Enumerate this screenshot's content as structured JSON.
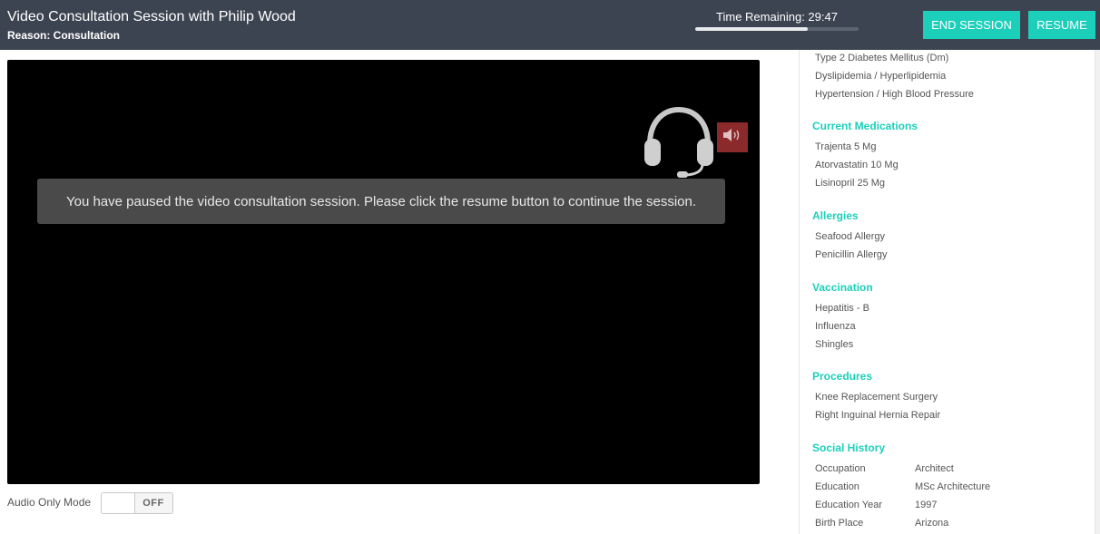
{
  "header": {
    "title": "Video Consultation Session with Philip Wood",
    "reason": "Reason: Consultation",
    "timer_text": "Time Remaining: 29:47",
    "timer_progress": 0.69,
    "end_session_label": "END SESSION",
    "resume_label": "RESUME"
  },
  "video": {
    "paused_message": "You have paused the video consultation session. Please click the resume button to continue the session.",
    "headset_icon": "headset-icon",
    "speaker_icon": "speaker-muted-icon"
  },
  "audio_only": {
    "label": "Audio Only Mode",
    "state": "OFF"
  },
  "sidebar": {
    "conditions": [
      "Type 2 Diabetes Mellitus (Dm)",
      "Dyslipidemia / Hyperlipidemia",
      "Hypertension / High Blood Pressure"
    ],
    "medications": {
      "title": "Current Medications",
      "items": [
        "Trajenta 5 Mg",
        "Atorvastatin 10 Mg",
        "Lisinopril 25 Mg"
      ]
    },
    "allergies": {
      "title": "Allergies",
      "items": [
        "Seafood Allergy",
        "Penicillin Allergy"
      ]
    },
    "vaccination": {
      "title": "Vaccination",
      "items": [
        "Hepatitis - B",
        "Influenza",
        "Shingles"
      ]
    },
    "procedures": {
      "title": "Procedures",
      "items": [
        "Knee Replacement Surgery",
        "Right Inguinal Hernia Repair"
      ]
    },
    "social_history": {
      "title": "Social History",
      "rows": [
        {
          "label": "Occupation",
          "value": "Architect"
        },
        {
          "label": "Education",
          "value": "MSc Architecture"
        },
        {
          "label": "Education Year",
          "value": "1997"
        },
        {
          "label": "Birth Place",
          "value": "Arizona"
        }
      ]
    }
  },
  "colors": {
    "header_bg": "#3d4451",
    "accent": "#1ccfbb",
    "video_bg": "#000000",
    "mute_red": "#8b2a2a"
  }
}
